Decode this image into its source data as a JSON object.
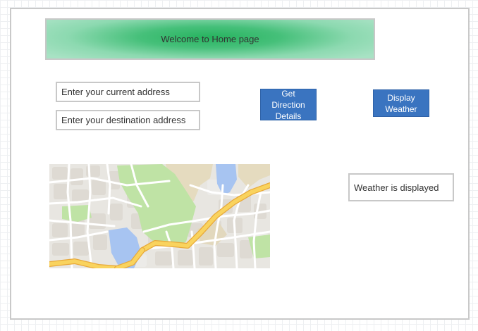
{
  "banner": {
    "title": "Welcome to Home page"
  },
  "form": {
    "current_address_placeholder": "Enter your current address",
    "destination_address_placeholder": "Enter your destination address"
  },
  "buttons": {
    "directions_label": "Get\nDirection\nDetails",
    "weather_label": "Display\nWeather"
  },
  "weather": {
    "status_text": "Weather is displayed"
  },
  "colors": {
    "banner_green": "#27b35f",
    "button_blue": "#3a74c0",
    "map_park": "#bfe3a5",
    "map_water": "#a7c4f1",
    "map_route": "#f9d35e"
  }
}
